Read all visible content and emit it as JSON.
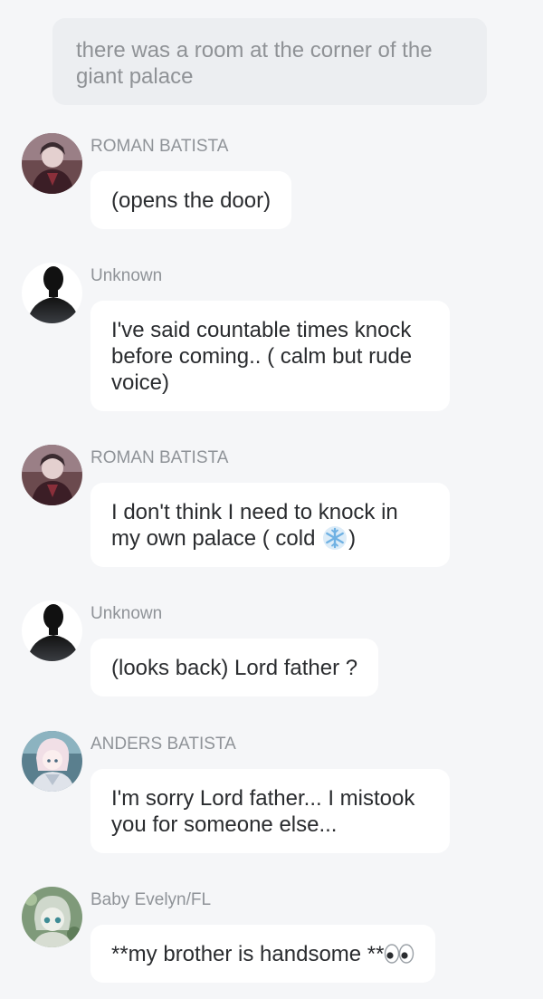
{
  "narration": "there was a room at the corner of the giant palace",
  "messages": [
    {
      "sender": "ROMAN BATISTA",
      "text": "(opens the door)",
      "avatar": "roman-avatar"
    },
    {
      "sender": "Unknown",
      "text": "I've said countable times knock before coming.. ( calm but rude voice)",
      "avatar": "silhouette-avatar"
    },
    {
      "sender": "ROMAN BATISTA",
      "text_before": "I don't think I need to knock in my own palace ( cold ",
      "text_after": ")",
      "avatar": "roman-avatar",
      "emoji": "snowflake-icon"
    },
    {
      "sender": "Unknown",
      "text": "(looks back) Lord father ?",
      "avatar": "silhouette-avatar"
    },
    {
      "sender": "ANDERS BATISTA",
      "text": "I'm sorry Lord father... I mistook you for someone else...",
      "avatar": "anders-avatar"
    },
    {
      "sender": "Baby Evelyn/FL",
      "text": "**my brother is handsome **",
      "avatar": "evelyn-avatar",
      "emoji": "eyes-icon"
    }
  ],
  "colors": {
    "background": "#f5f6f8",
    "narration_bg": "#eceef1",
    "bubble_bg": "#ffffff",
    "sender_text": "#8f9398",
    "message_text": "#2a2c2f"
  }
}
